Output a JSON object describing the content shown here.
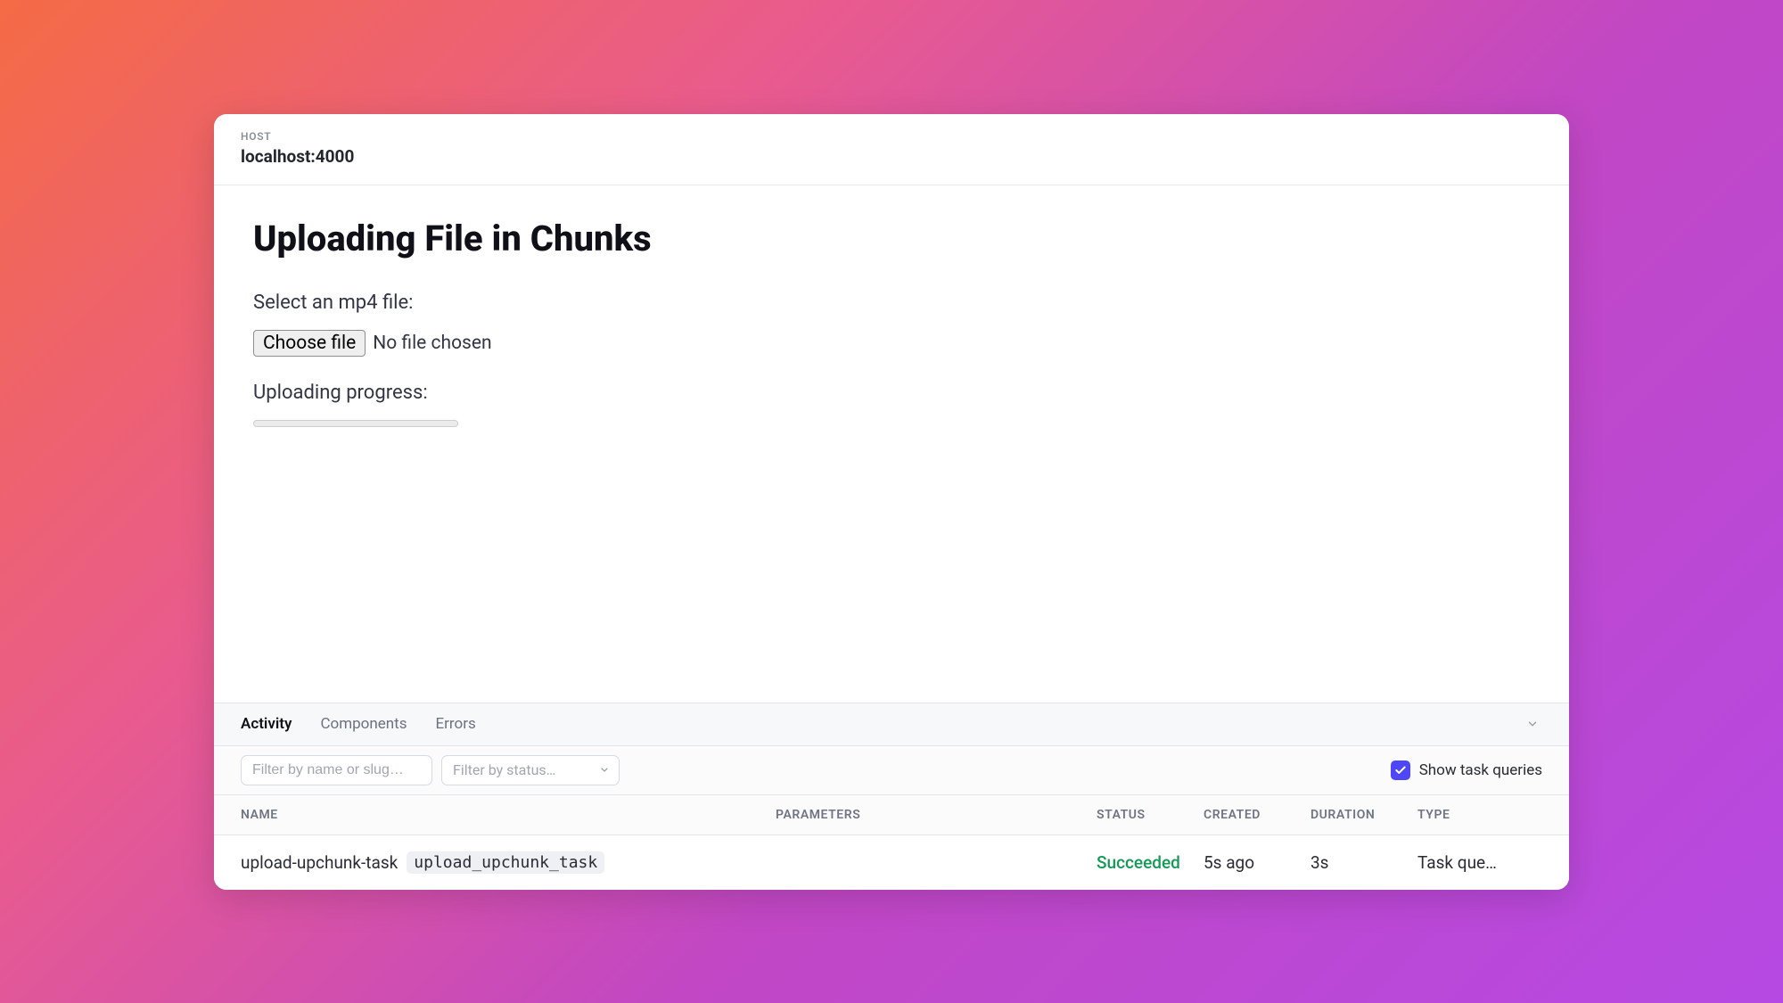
{
  "header": {
    "host_label": "HOST",
    "host_value": "localhost:4000"
  },
  "main": {
    "title": "Uploading File in Chunks",
    "select_label": "Select an mp4 file:",
    "choose_file_label": "Choose file",
    "no_file_text": "No file chosen",
    "progress_label": "Uploading progress:",
    "progress_value": 0
  },
  "panel": {
    "tabs": [
      {
        "label": "Activity",
        "active": true
      },
      {
        "label": "Components",
        "active": false
      },
      {
        "label": "Errors",
        "active": false
      }
    ],
    "filters": {
      "name_placeholder": "Filter by name or slug…",
      "status_placeholder": "Filter by status…"
    },
    "show_task_queries": {
      "checked": true,
      "label": "Show task queries"
    },
    "columns": {
      "name": "NAME",
      "parameters": "PARAMETERS",
      "status": "STATUS",
      "created": "CREATED",
      "duration": "DURATION",
      "type": "TYPE"
    },
    "rows": [
      {
        "name": "upload-upchunk-task",
        "slug": "upload_upchunk_task",
        "parameters": "",
        "status": "Succeeded",
        "created": "5s ago",
        "duration": "3s",
        "type": "Task que…"
      }
    ]
  },
  "colors": {
    "accent": "#4f46f8",
    "success": "#159957"
  }
}
